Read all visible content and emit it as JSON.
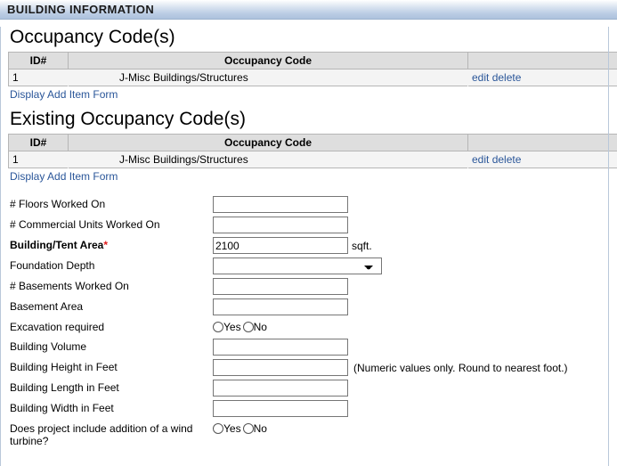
{
  "window": {
    "title": "BUILDING INFORMATION"
  },
  "colors": {
    "titlebar_start": "#ffffff",
    "titlebar_end": "#aec3de",
    "link": "#2a5699",
    "required_star": "#e01b1b",
    "grid_header_bg": "#dedede",
    "grid_row_bg": "#f4f4f4",
    "grid_border": "#b6b6b6"
  },
  "sections": {
    "occupancy": {
      "heading": "Occupancy Code(s)",
      "columns": [
        "ID#",
        "Occupancy Code",
        ""
      ],
      "rows": [
        {
          "id": "1",
          "code": "J-Misc Buildings/Structures",
          "edit_label": "edit",
          "delete_label": "delete"
        }
      ],
      "add_link": "Display Add Item Form"
    },
    "existing_occupancy": {
      "heading": "Existing Occupancy Code(s)",
      "columns": [
        "ID#",
        "Occupancy Code",
        ""
      ],
      "rows": [
        {
          "id": "1",
          "code": "J-Misc Buildings/Structures",
          "edit_label": "edit",
          "delete_label": "delete"
        }
      ],
      "add_link": "Display Add Item Form"
    }
  },
  "form": {
    "floors_worked_on": {
      "label": "# Floors Worked On",
      "value": "",
      "placeholder": ""
    },
    "commercial_units": {
      "label": "# Commercial Units Worked On",
      "value": "",
      "placeholder": ""
    },
    "building_tent_area": {
      "label": "Building/Tent Area",
      "required_marker": "*",
      "value": "2100",
      "placeholder": "",
      "suffix": "sqft."
    },
    "foundation_depth": {
      "label": "Foundation Depth",
      "selected": "",
      "options": [
        ""
      ]
    },
    "basements_worked_on": {
      "label": "# Basements Worked On",
      "value": "",
      "placeholder": ""
    },
    "basement_area": {
      "label": "Basement Area",
      "value": "",
      "placeholder": ""
    },
    "excavation_required": {
      "label": "Excavation required",
      "yes_label": "Yes",
      "no_label": "No",
      "selected": ""
    },
    "building_volume": {
      "label": "Building Volume",
      "value": "",
      "placeholder": ""
    },
    "building_height": {
      "label": "Building Height in Feet",
      "value": "",
      "placeholder": "",
      "hint": "(Numeric values only. Round to nearest foot.)"
    },
    "building_length": {
      "label": "Building Length in Feet",
      "value": "",
      "placeholder": ""
    },
    "building_width": {
      "label": "Building Width in Feet",
      "value": "",
      "placeholder": ""
    },
    "wind_turbine": {
      "label": "Does project include addition of a wind turbine?",
      "yes_label": "Yes",
      "no_label": "No",
      "selected": ""
    }
  }
}
